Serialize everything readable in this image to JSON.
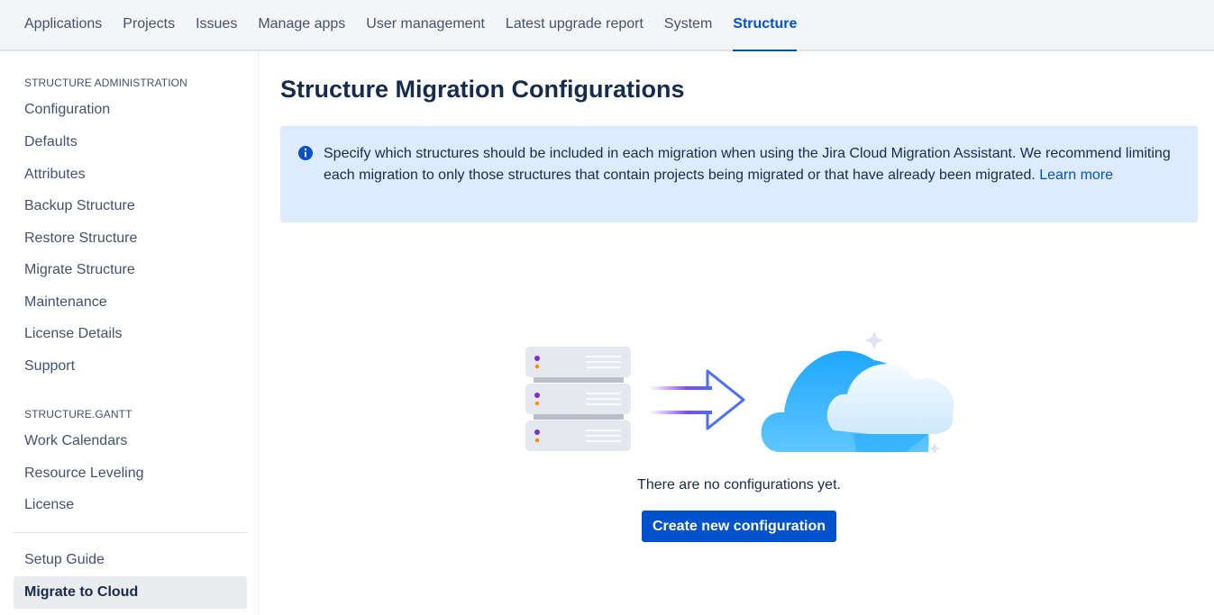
{
  "topnav": {
    "tabs": [
      {
        "label": "Applications"
      },
      {
        "label": "Projects"
      },
      {
        "label": "Issues"
      },
      {
        "label": "Manage apps"
      },
      {
        "label": "User management"
      },
      {
        "label": "Latest upgrade report"
      },
      {
        "label": "System"
      },
      {
        "label": "Structure",
        "active": true
      }
    ]
  },
  "sidebar": {
    "section1_title": "STRUCTURE ADMINISTRATION",
    "section1_items": [
      "Configuration",
      "Defaults",
      "Attributes",
      "Backup Structure",
      "Restore Structure",
      "Migrate Structure",
      "Maintenance",
      "License Details",
      "Support"
    ],
    "section2_title": "STRUCTURE.GANTT",
    "section2_items": [
      "Work Calendars",
      "Resource Leveling",
      "License"
    ],
    "bottom_items": [
      "Setup Guide",
      "Migrate to Cloud"
    ],
    "selected_item": "Migrate to Cloud"
  },
  "main": {
    "title": "Structure Migration Configurations",
    "banner": {
      "icon": "info-icon",
      "text": "Specify which structures should be included in each migration when using the Jira Cloud Migration Assistant. We recommend limiting each migration to only those structures that contain projects being migrated or that have already been migrated.",
      "link_text": "Learn more"
    },
    "illustration": "server-to-cloud-illustration",
    "empty_message": "There are no configurations yet.",
    "create_button": "Create new configuration"
  },
  "colors": {
    "primary": "#0052cc",
    "banner_bg": "#deebff",
    "text": "#172b4d",
    "muted": "#42526e"
  }
}
